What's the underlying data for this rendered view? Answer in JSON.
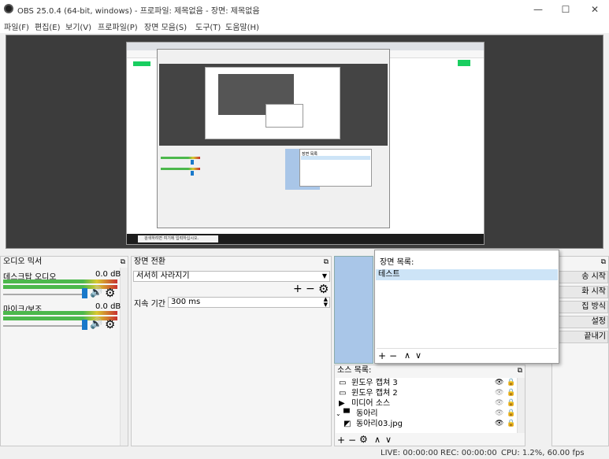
{
  "window": {
    "title": "OBS 25.0.4 (64-bit, windows) - 프로파일: 제목없음 - 장면: 제목없음",
    "minimize": "—",
    "maximize": "☐",
    "close": "✕"
  },
  "menu": [
    "파일(F)",
    "편집(E)",
    "보기(V)",
    "프로파일(P)",
    "장면 모음(S)",
    "도구(T)",
    "도움말(H)"
  ],
  "preview": {
    "taskbar_search": "검색하려면 여기에 입력하십시오.",
    "mini_popup_title": "장면 목록"
  },
  "audio_mixer": {
    "title": "오디오 믹서",
    "channels": [
      {
        "name": "데스크탑 오디오",
        "level": "0.0 dB"
      },
      {
        "name": "마이크/보조",
        "level": "0.0 dB"
      }
    ]
  },
  "transitions": {
    "title": "장면 전환",
    "selected": "서서히 사라지기",
    "duration_label": "지속 기간",
    "duration_value": "300 ms"
  },
  "scene_list_popup": {
    "title": "장면 목록:",
    "items": [
      "테스트"
    ]
  },
  "sources": {
    "title": "소스 목록:",
    "items": [
      {
        "icon": "window-icon",
        "glyph": "▭",
        "name": "윈도우 캡쳐 3"
      },
      {
        "icon": "window-icon",
        "glyph": "▭",
        "name": "윈도우 캡쳐 2"
      },
      {
        "icon": "play-icon",
        "glyph": "▶",
        "name": "미디어 소스"
      },
      {
        "icon": "folder-icon",
        "glyph": "▀",
        "name": "동아리"
      },
      {
        "icon": "image-icon",
        "glyph": "◩",
        "name": "동아리03.jpg"
      }
    ]
  },
  "controls": {
    "buttons": [
      "송 시작",
      "화 시작",
      "집 방식",
      "설정",
      "끝내기"
    ]
  },
  "status": {
    "live": "LIVE: 00:00:00",
    "rec": "REC: 00:00:00",
    "cpu": "CPU: 1.2%, 60.00 fps"
  },
  "colors": {
    "accent": "#1979ca",
    "selection": "#cde4f7",
    "preview_bg": "#3c3c3c"
  }
}
